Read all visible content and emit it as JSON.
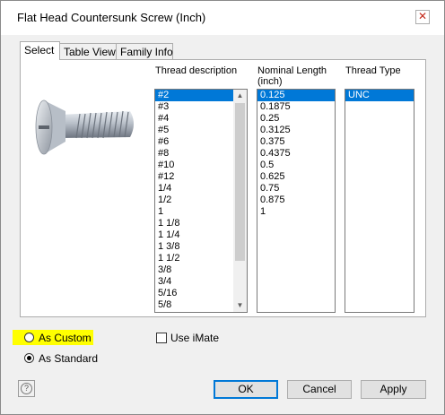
{
  "window": {
    "title": "Flat Head Countersunk Screw (Inch)",
    "close_glyph": "✕"
  },
  "tabs": [
    {
      "label": "Select"
    },
    {
      "label": "Table View"
    },
    {
      "label": "Family Info"
    }
  ],
  "columns": {
    "thread_description": {
      "label": "Thread description"
    },
    "nominal_length": {
      "label_line1": "Nominal Length",
      "label_line2": "(inch)"
    },
    "thread_type": {
      "label": "Thread Type"
    }
  },
  "thread_descriptions": [
    "#2",
    "#3",
    "#4",
    "#5",
    "#6",
    "#8",
    "#10",
    "#12",
    "1/4",
    "1/2",
    "1",
    "1 1/8",
    "1 1/4",
    "1 3/8",
    "1 1/2",
    "3/8",
    "3/4",
    "5/16",
    "5/8"
  ],
  "nominal_lengths": [
    "0.125",
    "0.1875",
    "0.25",
    "0.3125",
    "0.375",
    "0.4375",
    "0.5",
    "0.625",
    "0.75",
    "0.875",
    "1"
  ],
  "thread_types": [
    "UNC"
  ],
  "options": {
    "as_custom": "As Custom",
    "as_standard": "As Standard",
    "use_imate": "Use iMate"
  },
  "buttons": {
    "ok": "OK",
    "cancel": "Cancel",
    "apply": "Apply",
    "help_glyph": "?"
  },
  "colors": {
    "selection": "#0078d7",
    "highlight": "#ffff00",
    "dialog_bg": "#f0f0f0"
  },
  "icons": {
    "help": "help-icon",
    "close": "close-icon",
    "preview": "screw-preview-image"
  }
}
